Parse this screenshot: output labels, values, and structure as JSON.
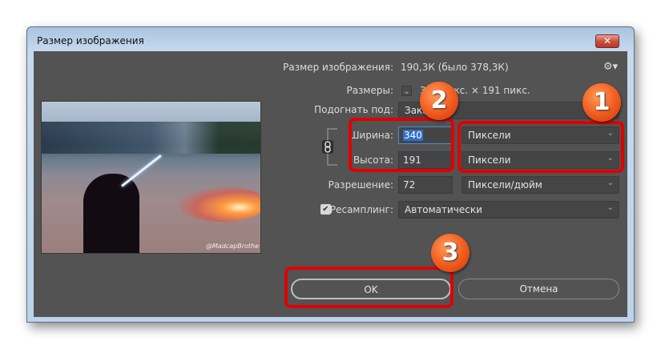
{
  "window": {
    "title": "Размер изображения",
    "close_icon": "close-icon"
  },
  "info": {
    "size_label": "Размер изображения:",
    "size_value": "190,3К (было 378,3К)",
    "dims_label": "Размеры:",
    "dims_value": "340 пикс.  ×  191 пикс."
  },
  "fit": {
    "label": "Подогнать под:",
    "value": "Заказной"
  },
  "width": {
    "label": "Ширина:",
    "value": "340",
    "unit": "Пиксели"
  },
  "height": {
    "label": "Высота:",
    "value": "191",
    "unit": "Пиксели"
  },
  "resolution": {
    "label": "Разрешение:",
    "value": "72",
    "unit": "Пиксели/дюйм"
  },
  "resample": {
    "label": "Ресамплинг:",
    "value": "Автоматически",
    "checked": true
  },
  "buttons": {
    "ok": "OK",
    "cancel": "Отмена"
  },
  "preview": {
    "watermark": "@MadcapBrothe"
  },
  "badges": [
    "1",
    "2",
    "3"
  ],
  "colors": {
    "annotation_red": "#e00000",
    "badge_orange": "#f05a1c",
    "panel": "#535353"
  }
}
